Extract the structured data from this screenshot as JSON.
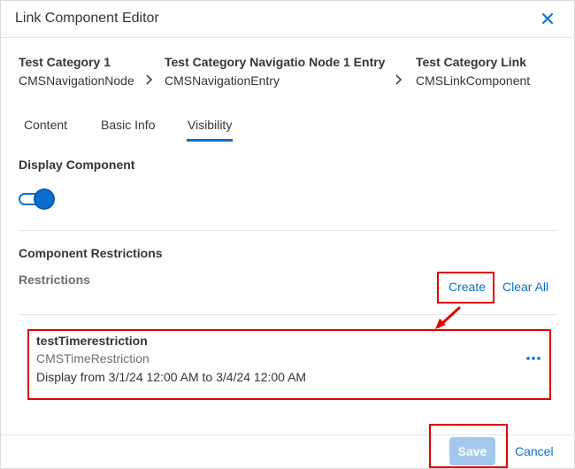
{
  "dialog": {
    "title": "Link Component Editor"
  },
  "breadcrumb": [
    {
      "title": "Test Category 1",
      "type": "CMSNavigationNode"
    },
    {
      "title": "Test Category Navigatio Node 1 Entry",
      "type": "CMSNavigationEntry"
    },
    {
      "title": "Test Category Link",
      "type": "CMSLinkComponent"
    }
  ],
  "tabs": [
    {
      "label": "Content"
    },
    {
      "label": "Basic Info"
    },
    {
      "label": "Visibility",
      "active": true
    }
  ],
  "visibility": {
    "display_label": "Display Component",
    "display_on": true
  },
  "restrictions": {
    "section_label": "Component Restrictions",
    "list_label": "Restrictions",
    "create_label": "Create",
    "clear_label": "Clear All",
    "items": [
      {
        "name": "testTimerestriction",
        "type": "CMSTimeRestriction",
        "description": "Display from 3/1/24 12:00 AM to 3/4/24 12:00 AM"
      }
    ]
  },
  "footer": {
    "save_label": "Save",
    "cancel_label": "Cancel"
  },
  "colors": {
    "accent": "#0a6ed1",
    "annotation": "#e00000",
    "save_disabled": "#a3c8ec"
  },
  "icons": {
    "close": "close-icon",
    "breadcrumb_separator": "chevron-right-icon",
    "more": "overflow-icon",
    "annotation_arrow": "arrow-icon"
  }
}
